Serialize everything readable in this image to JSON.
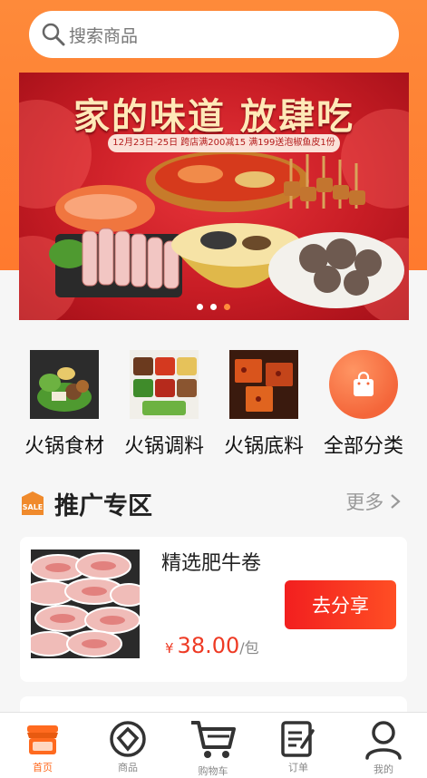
{
  "search": {
    "placeholder": "搜索商品"
  },
  "banner": {
    "title": "家的味道 放肆吃",
    "subtitle": "12月23日-25日 跨店满200减15 满199送泡椒鱼皮1份",
    "dots": 3,
    "active_dot": 2
  },
  "categories": [
    {
      "label": "火锅食材"
    },
    {
      "label": "火锅调料"
    },
    {
      "label": "火锅底料"
    },
    {
      "label": "全部分类"
    }
  ],
  "promo": {
    "title": "推广专区",
    "more": "更多",
    "sale_badge": "SALE"
  },
  "product": {
    "name": "精选肥牛卷",
    "currency": "¥",
    "price": "38.00",
    "unit": "/包",
    "button": "去分享"
  },
  "tabbar": [
    {
      "label": "首页",
      "active": true
    },
    {
      "label": "商品",
      "active": false
    },
    {
      "label": "购物车",
      "active": false
    },
    {
      "label": "订单",
      "active": false
    },
    {
      "label": "我的",
      "active": false
    }
  ],
  "colors": {
    "accent": "#ff6a1f",
    "price": "#ee3a24",
    "button": "#f21f1f"
  }
}
